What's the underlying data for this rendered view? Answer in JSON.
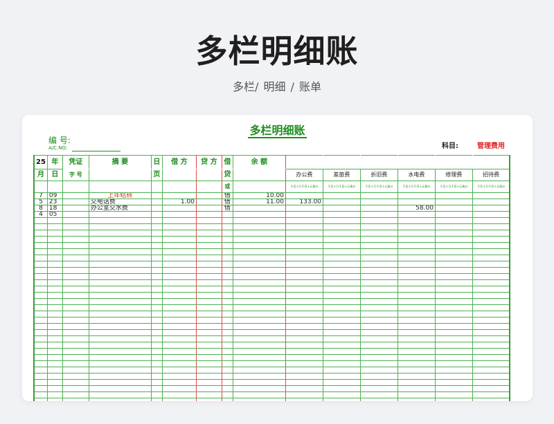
{
  "page": {
    "title": "多栏明细账",
    "subtitle": "多栏/  明细  /  账单"
  },
  "sheet": {
    "title": "多栏明细账",
    "account_label": "编 号:",
    "account_sub": "A/C.NO:",
    "subject_label": "科目:",
    "subject_value": "管理费用",
    "headers": {
      "period": "25",
      "year": "年",
      "month": "月",
      "day": "日",
      "voucher": "凭证",
      "voucher_no": "字 号",
      "summary": "摘  要",
      "page_top": "日",
      "page_bottom": "页",
      "debit": "借  方",
      "credit": "贷  方",
      "dir_1": "借",
      "dir_2": "或",
      "dir_3": "贷",
      "balance": "余  额",
      "digits": "千百十万千百十元角分"
    },
    "categories": [
      "办公费",
      "差旅费",
      "折旧费",
      "水电费",
      "修理费",
      "招待费"
    ],
    "rows": [
      {
        "month": "7",
        "day": "09",
        "summary": "上年结转",
        "debit": "",
        "dir": "借",
        "balance": "10.00",
        "cats": [
          "",
          "",
          "",
          "",
          "",
          ""
        ]
      },
      {
        "month": "5",
        "day": "23",
        "summary": "交电话费",
        "debit": "1.00",
        "dir": "借",
        "balance": "11.00",
        "cats": [
          "133.00",
          "",
          "",
          "",
          "",
          ""
        ]
      },
      {
        "month": "8",
        "day": "18",
        "summary": "办公室交水费",
        "debit": "",
        "dir": "借",
        "balance": "",
        "cats": [
          "",
          "",
          "",
          "58.00",
          "",
          ""
        ]
      },
      {
        "month": "4",
        "day": "05",
        "summary": "",
        "debit": "",
        "dir": "",
        "balance": "",
        "cats": [
          "",
          "",
          "",
          "",
          "",
          ""
        ]
      }
    ],
    "empty_rows": 30,
    "colors": {
      "green": "#1f8d1f",
      "grid": "#4caf50",
      "red": "#e02222"
    }
  }
}
